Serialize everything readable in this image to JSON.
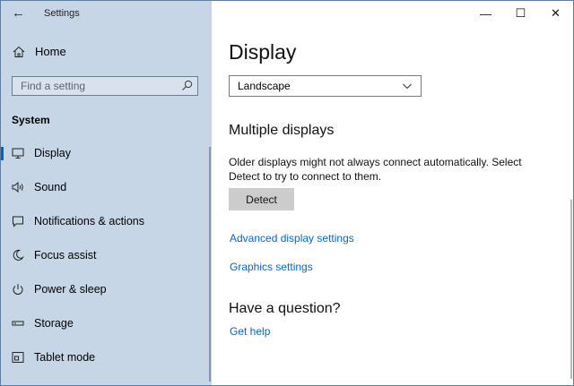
{
  "window": {
    "title": "Settings",
    "controls": [
      "—",
      "☐",
      "✕"
    ]
  },
  "sidebar": {
    "home_label": "Home",
    "search_placeholder": "Find a setting",
    "section_label": "System",
    "items": [
      {
        "label": "Display",
        "icon": "monitor-icon",
        "active": true
      },
      {
        "label": "Sound",
        "icon": "speaker-icon"
      },
      {
        "label": "Notifications & actions",
        "icon": "notification-icon"
      },
      {
        "label": "Focus assist",
        "icon": "moon-icon"
      },
      {
        "label": "Power & sleep",
        "icon": "power-icon"
      },
      {
        "label": "Storage",
        "icon": "storage-icon"
      },
      {
        "label": "Tablet mode",
        "icon": "tablet-icon"
      }
    ]
  },
  "main": {
    "title": "Display",
    "orientation_value": "Landscape",
    "multiple_displays_heading": "Multiple displays",
    "multiple_displays_desc": "Older displays might not always connect automatically. Select Detect to try to connect to them.",
    "detect_label": "Detect",
    "advanced_link": "Advanced display settings",
    "graphics_link": "Graphics settings",
    "question_heading": "Have a question?",
    "help_link": "Get help"
  },
  "colors": {
    "sidebar_bg": "#c7d6e6",
    "accent": "#0b61b5",
    "link": "#0b66bd"
  }
}
